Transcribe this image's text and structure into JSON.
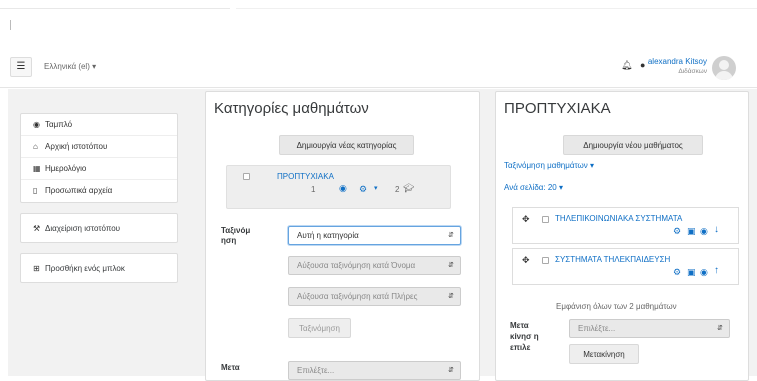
{
  "navbar": {
    "menu_icon": "hamburger-icon",
    "language": "Ελληνικά (el) ▾",
    "user_name": "alexandra Kitsoy",
    "user_role": "Διδάσκων"
  },
  "drawer": {
    "group1": [
      {
        "icon": "dashboard-icon",
        "glyph": "◉",
        "label": "Ταμπλό"
      },
      {
        "icon": "home-icon",
        "glyph": "⌂",
        "label": "Αρχική ιστοτόπου"
      },
      {
        "icon": "calendar-icon",
        "glyph": "▦",
        "label": "Ημερολόγιο"
      },
      {
        "icon": "file-icon",
        "glyph": "▯",
        "label": "Προσωπικά αρχεία"
      }
    ],
    "admin": {
      "icon": "wrench-icon",
      "glyph": "⚒",
      "label": "Διαχείριση ιστοτόπου"
    },
    "addblock": {
      "icon": "plus-square-icon",
      "glyph": "⊞",
      "label": "Προσθήκη ενός μπλοκ"
    }
  },
  "categories": {
    "title": "Κατηγορίες μαθημάτων",
    "create_button": "Δημιουργία νέας κατηγορίας",
    "item": {
      "name": "ΠΡΟΠΤΥΧΙΑΚΑ",
      "count": "1",
      "courses": "2"
    },
    "sort_label": "Ταξινόμ ηση",
    "sort_select": "Αυτή η κατηγορία",
    "sort_by_name": "Αύξουσα ταξινόμηση κατά Όνομα",
    "sort_by_full": "Αύξουσα ταξινόμηση κατά Πλήρες",
    "sort_button": "Ταξινόμηση",
    "move_label": "Μετα",
    "move_select": "Επιλέξτε..."
  },
  "courses": {
    "title": "ΠΡΟΠΤΥΧΙΑΚΑ",
    "create_button": "Δημιουργία νέου μαθήματος",
    "sort_link": "Ταξινόμηση μαθημάτων ▾",
    "per_page": "Ανά σελίδα: 20 ▾",
    "items": [
      {
        "name": "ΤΗΛΕΠΙΚΟΙΝΩΝΙΑΚΑ ΣΥΣΤΗΜΑΤΑ",
        "arrow": "↓"
      },
      {
        "name": "ΣΥΣΤΗΜΑΤΑ ΤΗΛΕΚΠΑΙΔΕΥΣΗ",
        "arrow": "↑"
      }
    ],
    "show_all": "Εμφάνιση όλων των 2 μαθημάτων",
    "move_label": "Μετα κίνησ η επιλε",
    "move_select": "Επιλέξτε...",
    "move_button": "Μετακίνηση"
  },
  "colors": {
    "link": "#0f6fc5",
    "page_bg": "#f2f2f2"
  }
}
